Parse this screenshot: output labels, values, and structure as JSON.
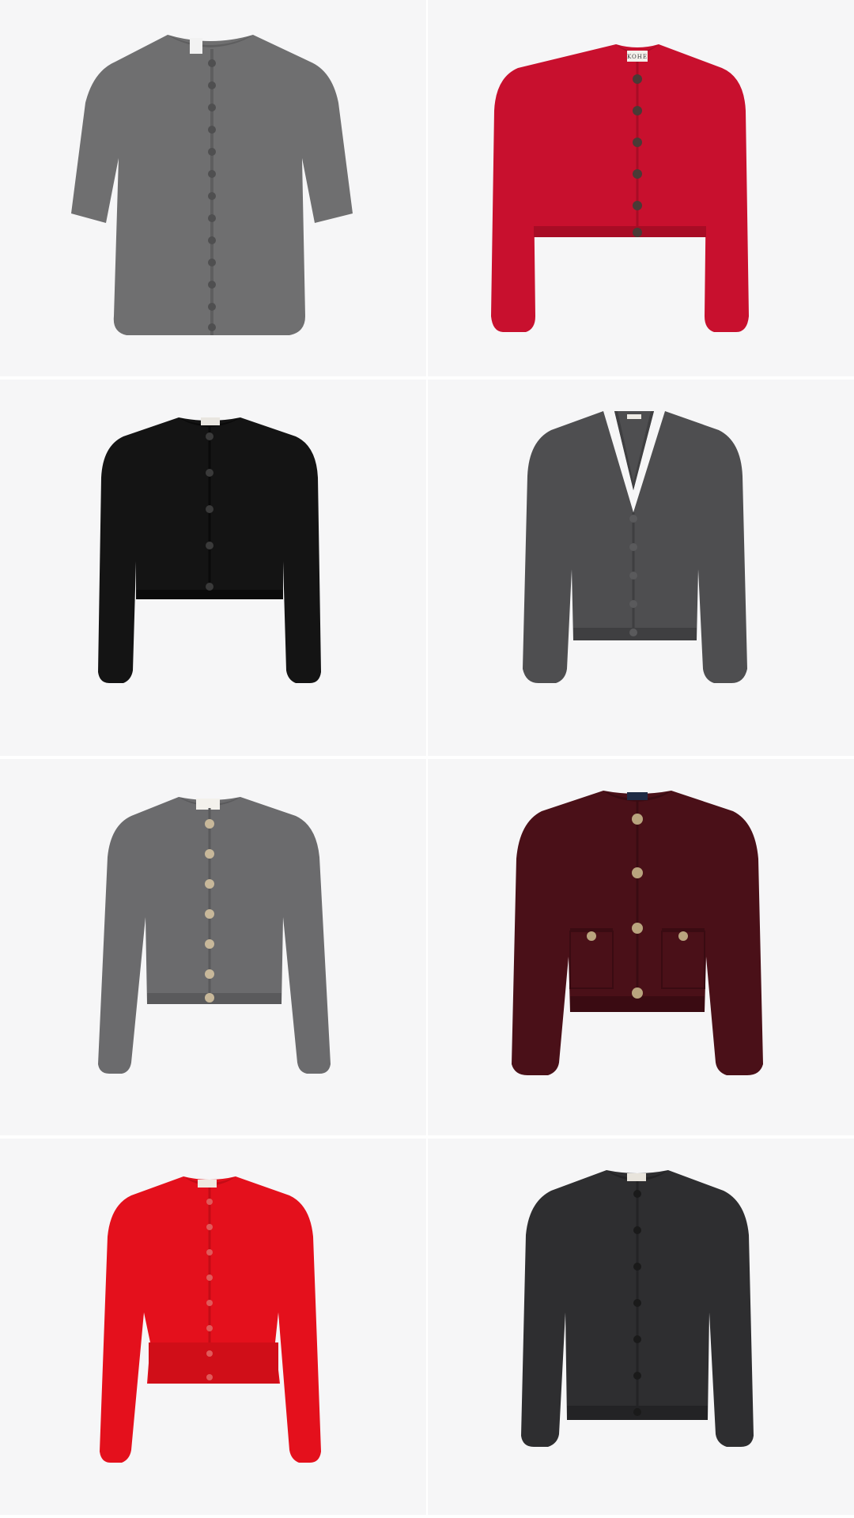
{
  "grid": {
    "items": [
      {
        "name": "grey-short-sleeve-cardigan",
        "color": "#6f6f70",
        "shade": "#5e5e5f",
        "button": "#4f4f50",
        "label": ""
      },
      {
        "name": "red-cropped-cardigan",
        "color": "#c8102e",
        "shade": "#a80c25",
        "button": "#4a3a36",
        "label": "KOHE"
      },
      {
        "name": "black-cropped-cardigan",
        "color": "#141414",
        "shade": "#0a0a0a",
        "button": "#3a3a3a",
        "label": ""
      },
      {
        "name": "charcoal-v-neck-cardigan",
        "color": "#4e4e50",
        "shade": "#3f3f41",
        "button": "#5a5a5c",
        "label": ""
      },
      {
        "name": "grey-crew-cardigan",
        "color": "#6b6b6d",
        "shade": "#5a5a5c",
        "button": "#c8b89a",
        "label": ""
      },
      {
        "name": "burgundy-pocket-cardigan",
        "color": "#4a1018",
        "shade": "#3a0b12",
        "button": "#b9a47e",
        "label": ""
      },
      {
        "name": "bright-red-cardigan",
        "color": "#e4101c",
        "shade": "#c40c16",
        "button": "#e05a5a",
        "label": ""
      },
      {
        "name": "charcoal-crew-cardigan",
        "color": "#2e2e30",
        "shade": "#232325",
        "button": "#1a1a1a",
        "label": ""
      }
    ]
  },
  "colors": {
    "tile_background": "#f6f6f7",
    "gutter": "#ffffff"
  }
}
